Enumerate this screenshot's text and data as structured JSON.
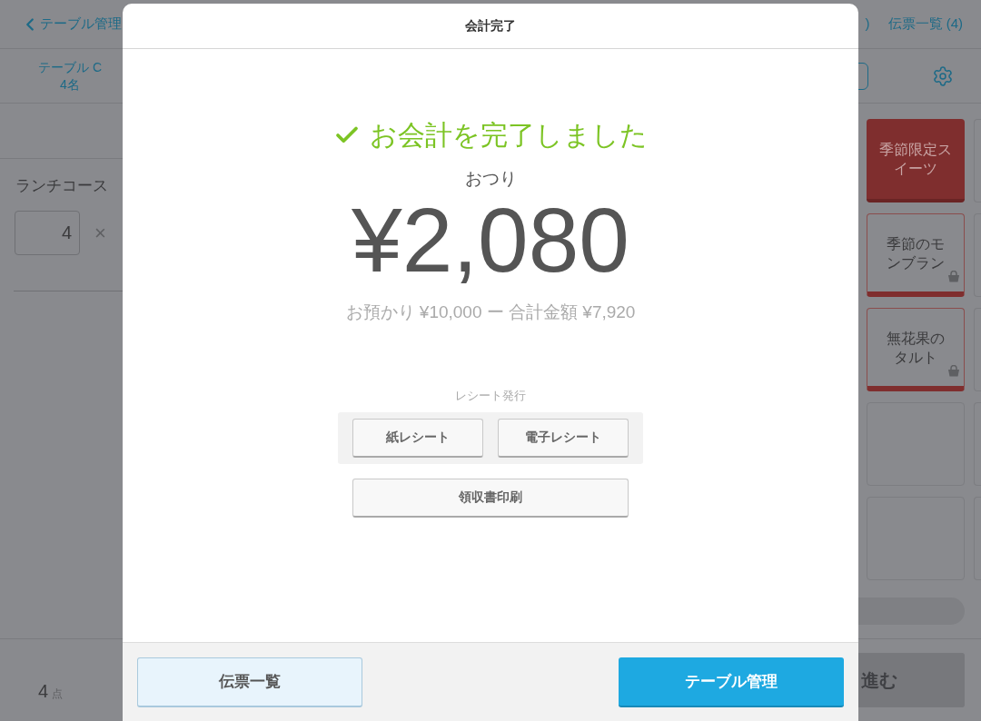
{
  "background": {
    "back_link": "テーブル管理",
    "header_partial": ")",
    "slips_link": "伝票一覧 (4)",
    "table_tab": {
      "name": "テーブル C",
      "guests": "4名"
    },
    "order_item": {
      "name": "ランチコース",
      "quantity": "4",
      "times": "×"
    },
    "menu_tiles": [
      {
        "label": "季節限定スイーツ",
        "kind": "category"
      },
      {
        "label": "季節のモンブラン",
        "kind": "item"
      },
      {
        "label": "無花果のタルト",
        "kind": "item"
      },
      {
        "kind": "empty"
      },
      {
        "kind": "empty"
      }
    ],
    "footer": {
      "count": "4",
      "unit": "点"
    },
    "next_button": "進む"
  },
  "modal": {
    "title": "会計完了",
    "message": "お会計を完了しました",
    "change_label": "おつり",
    "change_amount": "¥2,080",
    "summary": "お預かり ¥10,000 ー 合計金額 ¥7,920",
    "receipt_label": "レシート発行",
    "receipt_buttons": [
      "紙レシート",
      "電子レシート"
    ],
    "receipt_print": "領収書印刷",
    "footer_buttons": [
      {
        "label": "伝票一覧",
        "kind": "secondary"
      },
      {
        "label": "テーブル管理",
        "kind": "primary"
      }
    ]
  }
}
